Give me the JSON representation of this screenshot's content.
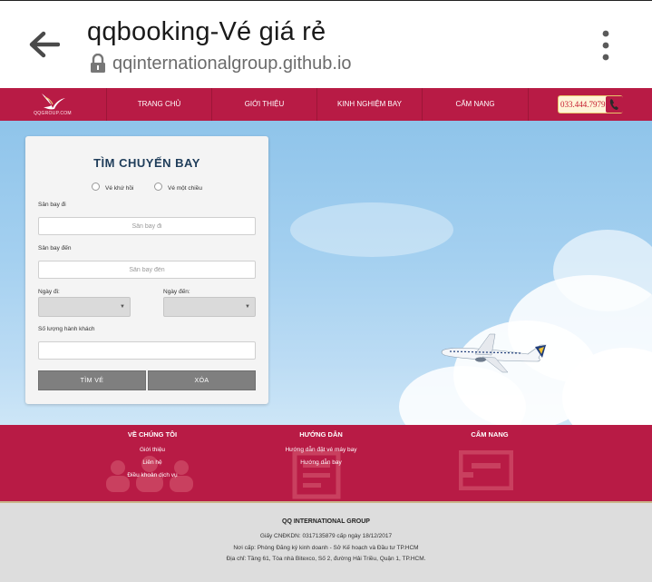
{
  "browser": {
    "tab_title": "qqbooking-Vé giá rẻ",
    "url": "qqinternationalgroup.github.io",
    "icons": [
      "back-arrow-icon",
      "lock-icon",
      "more-vertical-icon"
    ]
  },
  "nav": {
    "logo_text": "QQGROUP.COM",
    "items": [
      "TRANG CHỦ",
      "GIỚI THIỆU",
      "KINH NGHIỆM BAY",
      "CẨM NANG"
    ],
    "phone": "033.444.7979",
    "brand_color": "#b81b45"
  },
  "search_form": {
    "title": "TÌM CHUYẾN BAY",
    "trip_options": [
      "Vé khứ hồi",
      "Vé một chiều"
    ],
    "departure_label": "Sân bay đi",
    "departure_placeholder": "Sân bay đi",
    "arrival_label": "Sân bay đến",
    "arrival_placeholder": "Sân bay đến",
    "depart_date_label": "Ngày đi:",
    "return_date_label": "Ngày đến:",
    "passengers_label": "Số lượng hành khách",
    "search_button": "TÌM VÉ",
    "clear_button": "XÓA"
  },
  "footer": {
    "columns": [
      {
        "title": "VỀ CHÚNG TÔI",
        "links": [
          "Giới thiệu",
          "Liên hệ",
          "Điều khoản dịch vụ"
        ]
      },
      {
        "title": "HƯỚNG DẪN",
        "links": [
          "Hướng dẫn đặt vé máy bay",
          "Hướng dẫn bay"
        ]
      },
      {
        "title": "CẨM NANG",
        "links": []
      }
    ],
    "company": "QQ INTERNATIONAL GROUP",
    "license": "Giấy CNĐKDN: 0317135879 cấp ngày 18/12/2017",
    "issued_by": "Nơi cấp: Phòng Đăng ký kinh doanh - Sở Kế hoạch và Đầu tư TP.HCM",
    "address": "Địa chỉ: Tầng 61, Tòa nhà Bitexco, Số 2, đường Hải Triều, Quận 1, TP.HCM."
  }
}
